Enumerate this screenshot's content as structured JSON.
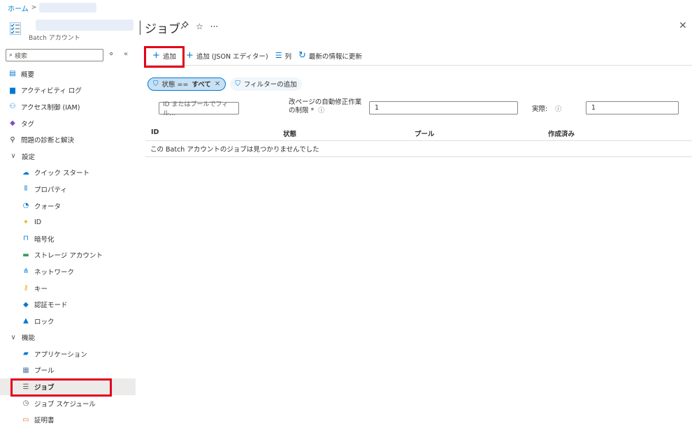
{
  "breadcrumb": {
    "home": "ホーム",
    "separator": ">"
  },
  "header": {
    "resource_type": "Batch アカウント",
    "title": "ジョブ",
    "pin_icon": "pin-icon",
    "star_icon": "star-icon",
    "more": "···",
    "close": "✕"
  },
  "sidebar": {
    "search_placeholder": "検索",
    "items": [
      {
        "label": "概要",
        "icon": "overview-icon",
        "level": 0
      },
      {
        "label": "アクティビティ ログ",
        "icon": "activity-log-icon",
        "level": 0
      },
      {
        "label": "アクセス制御 (IAM)",
        "icon": "iam-icon",
        "level": 0
      },
      {
        "label": "タグ",
        "icon": "tag-icon",
        "level": 0
      },
      {
        "label": "問題の診断と解決",
        "icon": "wrench-icon",
        "level": 0
      },
      {
        "label": "設定",
        "icon": "chevron-down-icon",
        "level": "group"
      },
      {
        "label": "クイック スタート",
        "icon": "cloud-icon",
        "level": 1
      },
      {
        "label": "プロパティ",
        "icon": "properties-icon",
        "level": 1
      },
      {
        "label": "クォータ",
        "icon": "quota-icon",
        "level": 1
      },
      {
        "label": "ID",
        "icon": "identity-icon",
        "level": 1
      },
      {
        "label": "暗号化",
        "icon": "lock-outline-icon",
        "level": 1
      },
      {
        "label": "ストレージ アカウント",
        "icon": "storage-icon",
        "level": 1
      },
      {
        "label": "ネットワーク",
        "icon": "network-icon",
        "level": 1
      },
      {
        "label": "キー",
        "icon": "key-icon",
        "level": 1
      },
      {
        "label": "認証モード",
        "icon": "auth-mode-icon",
        "level": 1
      },
      {
        "label": "ロック",
        "icon": "lock-icon",
        "level": 1
      },
      {
        "label": "機能",
        "icon": "chevron-down-icon",
        "level": "group"
      },
      {
        "label": "アプリケーション",
        "icon": "application-icon",
        "level": 1
      },
      {
        "label": "プール",
        "icon": "pool-icon",
        "level": 1
      },
      {
        "label": "ジョブ",
        "icon": "jobs-icon",
        "level": 1,
        "active": true
      },
      {
        "label": "ジョブ スケジュール",
        "icon": "job-schedule-icon",
        "level": 1
      },
      {
        "label": "証明書",
        "icon": "certificate-icon",
        "level": 1
      }
    ]
  },
  "toolbar": {
    "add": "追加",
    "add_json": "追加 (JSON エディター)",
    "columns": "列",
    "refresh": "最新の情報に更新"
  },
  "filters": {
    "state_key": "状態 ==",
    "state_value": "すべて",
    "add_filter": "フィルターの追加"
  },
  "fields": {
    "id_placeholder": "ID またはプールでフィル…",
    "limit_label_line1": "改ページの自動修正作業",
    "limit_label_line2": "の制限 *",
    "limit_value": "1",
    "actual_label": "実際:",
    "actual_value": "1"
  },
  "grid": {
    "columns": [
      "ID",
      "状態",
      "プール",
      "作成済み"
    ],
    "empty_message": "この Batch アカウントのジョブは見つかりませんでした"
  },
  "colors": {
    "accent": "#0078d4",
    "highlight": "#e3001b"
  }
}
